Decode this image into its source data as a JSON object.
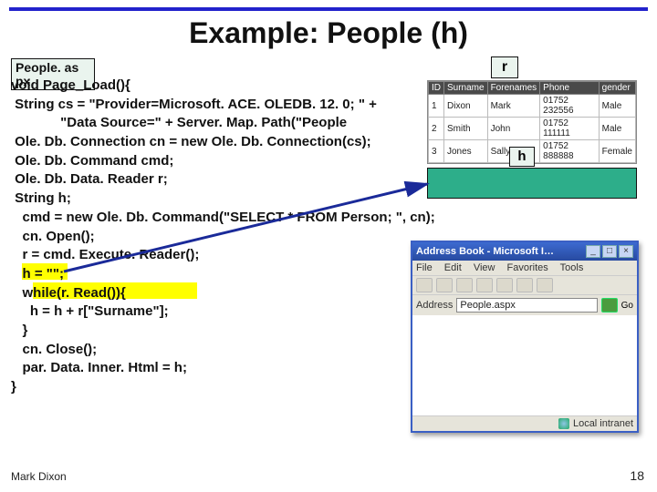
{
  "title": "Example: People (h)",
  "file_label": "People. as\npx",
  "author": "Mark Dixon",
  "page_number": "18",
  "r_label": "r",
  "h_label": "h",
  "code_lines": {
    "l0": "void Page_Load(){",
    "l1": " String cs = \"Provider=Microsoft. ACE. OLEDB. 12. 0; \" +",
    "l2": "             \"Data Source=\" + Server. Map. Path(\"People",
    "l3": " Ole. Db. Connection cn = new Ole. Db. Connection(cs);",
    "l4": " Ole. Db. Command cmd;",
    "l5": " Ole. Db. Data. Reader r;",
    "l6": " String h;",
    "l7": "   cmd = new Ole. Db. Command(\"SELECT * FROM Person; \", cn);",
    "l8": "   cn. Open();",
    "l9": "   r = cmd. Execute. Reader();",
    "l10": "   h = \"\";",
    "l11": "   while(r. Read()){",
    "l12": "     h = h + r[\"Surname\"];",
    "l13": "   }",
    "l14": "   cn. Close();",
    "l15": "   par. Data. Inner. Html = h;",
    "l16": "}"
  },
  "grid": {
    "headers": {
      "c0": "ID",
      "c1": "Surname",
      "c2": "Forenames",
      "c3": "Phone",
      "c4": "gender"
    },
    "rows": [
      {
        "c0": "1",
        "c1": "Dixon",
        "c2": "Mark",
        "c3": "01752 232556",
        "c4": "Male"
      },
      {
        "c0": "2",
        "c1": "Smith",
        "c2": "John",
        "c3": "01752 111111",
        "c4": "Male"
      },
      {
        "c0": "3",
        "c1": "Jones",
        "c2": "Sally",
        "c3": "01752 888888",
        "c4": "Female"
      }
    ]
  },
  "browser": {
    "title": "Address Book - Microsoft I…",
    "menu": {
      "file": "File",
      "edit": "Edit",
      "view": "View",
      "fav": "Favorites",
      "tools": "Tools"
    },
    "addr_label": "Address",
    "addr_value": "People.aspx",
    "go": "Go",
    "status": "Local intranet"
  }
}
